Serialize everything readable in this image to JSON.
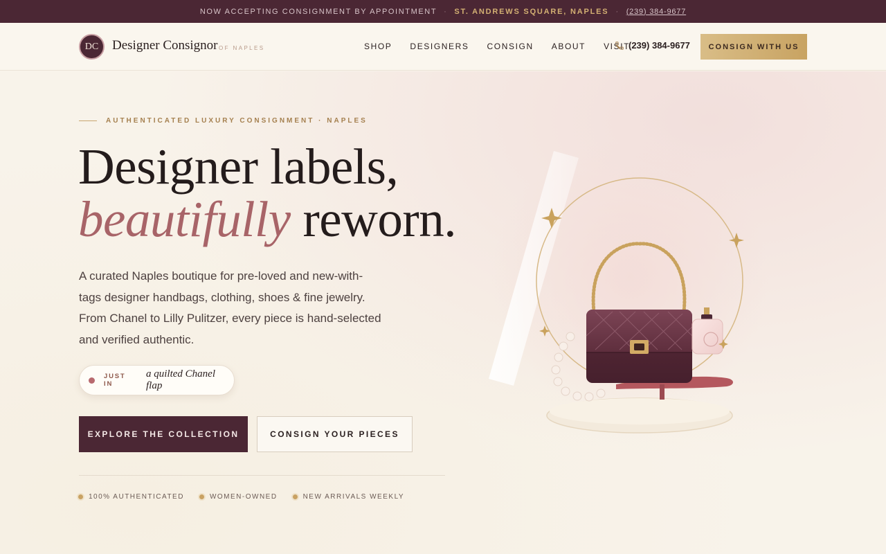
{
  "topbar": {
    "appointment": "NOW ACCEPTING CONSIGNMENT BY APPOINTMENT",
    "separator": "·",
    "location": "ST. ANDREWS SQUARE, NAPLES",
    "phone": "(239) 384-9677"
  },
  "header": {
    "logo_monogram": "DC",
    "logo_name": "Designer Consignor",
    "logo_sub": "OF NAPLES",
    "nav": [
      "SHOP",
      "DESIGNERS",
      "CONSIGN",
      "ABOUT",
      "VISIT"
    ],
    "phone_icon": "phone-icon",
    "phone": "(239) 384-9677",
    "cta": "CONSIGN WITH US"
  },
  "hero": {
    "eyebrow": "AUTHENTICATED LUXURY CONSIGNMENT · NAPLES",
    "headline_line1": "Designer labels,",
    "headline_italic": "beautifully",
    "headline_rest": " reworn.",
    "lead": "A curated Naples boutique for pre-loved and new-with-tags designer handbags, clothing, shoes & fine jewelry. From Chanel to Lilly Pulitzer, every piece is hand-selected and verified authentic.",
    "pill_tag": "JUST IN",
    "pill_text": "a quilted Chanel flap",
    "primary_button": "EXPLORE THE COLLECTION",
    "secondary_button": "CONSIGN YOUR PIECES",
    "badges": [
      "100% AUTHENTICATED",
      "WOMEN-OWNED",
      "NEW ARRIVALS WEEKLY"
    ]
  },
  "colors": {
    "plum": "#4b2734",
    "gold": "#c8a362",
    "rose": "#a86468",
    "cream": "#f8f3ea"
  },
  "illustration": {
    "icons": [
      "handbag-icon",
      "perfume-bottle-icon",
      "pearl-necklace-icon",
      "sparkle-icon"
    ]
  }
}
